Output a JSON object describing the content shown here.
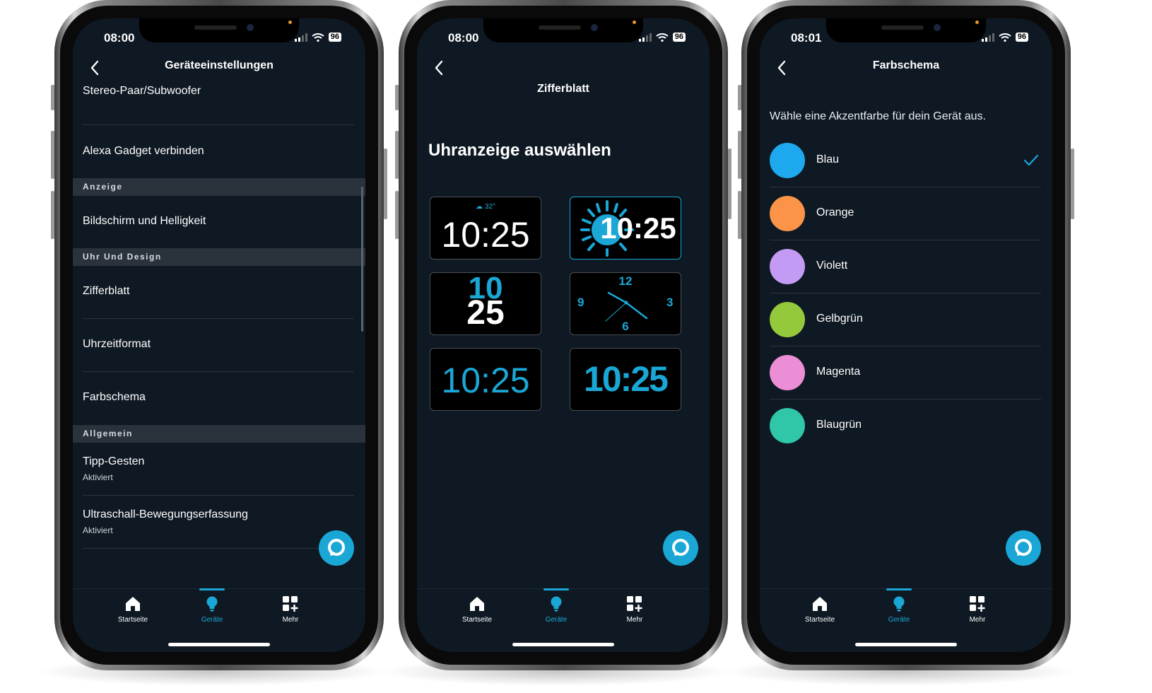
{
  "phones": [
    {
      "status_time": "08:00",
      "battery": "96",
      "title": "Geräteeinstellungen",
      "rows": {
        "stereo": "Stereo-Paar/Subwoofer",
        "gadget": "Alexa Gadget verbinden",
        "section_anzeige": "Anzeige",
        "bildschirm": "Bildschirm und Helligkeit",
        "section_uhr": "Uhr Und Design",
        "zifferblatt": "Zifferblatt",
        "uhrzeitformat": "Uhrzeitformat",
        "farbschema": "Farbschema",
        "section_allgemein": "Allgemein",
        "tipp": "Tipp-Gesten",
        "tipp_sub": "Aktiviert",
        "ultraschall": "Ultraschall-Bewegungserfassung",
        "ultraschall_sub": "Aktiviert"
      }
    },
    {
      "status_time": "08:00",
      "battery": "96",
      "title": "Zifferblatt",
      "heading": "Uhranzeige auswählen",
      "faces": {
        "temp": "32°",
        "time": "10:25",
        "hour": "10",
        "minute": "25",
        "n12": "12",
        "n3": "3",
        "n6": "6",
        "n9": "9"
      }
    },
    {
      "status_time": "08:01",
      "battery": "96",
      "title": "Farbschema",
      "intro": "Wähle eine Akzentfarbe für dein Gerät aus.",
      "colors": [
        {
          "label": "Blau",
          "hex": "#1ea9ee",
          "selected": true
        },
        {
          "label": "Orange",
          "hex": "#fb9448",
          "selected": false
        },
        {
          "label": "Violett",
          "hex": "#c39bf5",
          "selected": false
        },
        {
          "label": "Gelbgrün",
          "hex": "#95c93c",
          "selected": false
        },
        {
          "label": "Magenta",
          "hex": "#ec8ed6",
          "selected": false
        },
        {
          "label": "Blaugrün",
          "hex": "#2fc7a7",
          "selected": false
        }
      ]
    }
  ],
  "tabs": {
    "home": "Startseite",
    "devices": "Geräte",
    "more": "Mehr"
  },
  "colors": {
    "accent": "#1aa7d6",
    "screen_bg": "#0f1923",
    "section_bg": "#2a323c"
  }
}
